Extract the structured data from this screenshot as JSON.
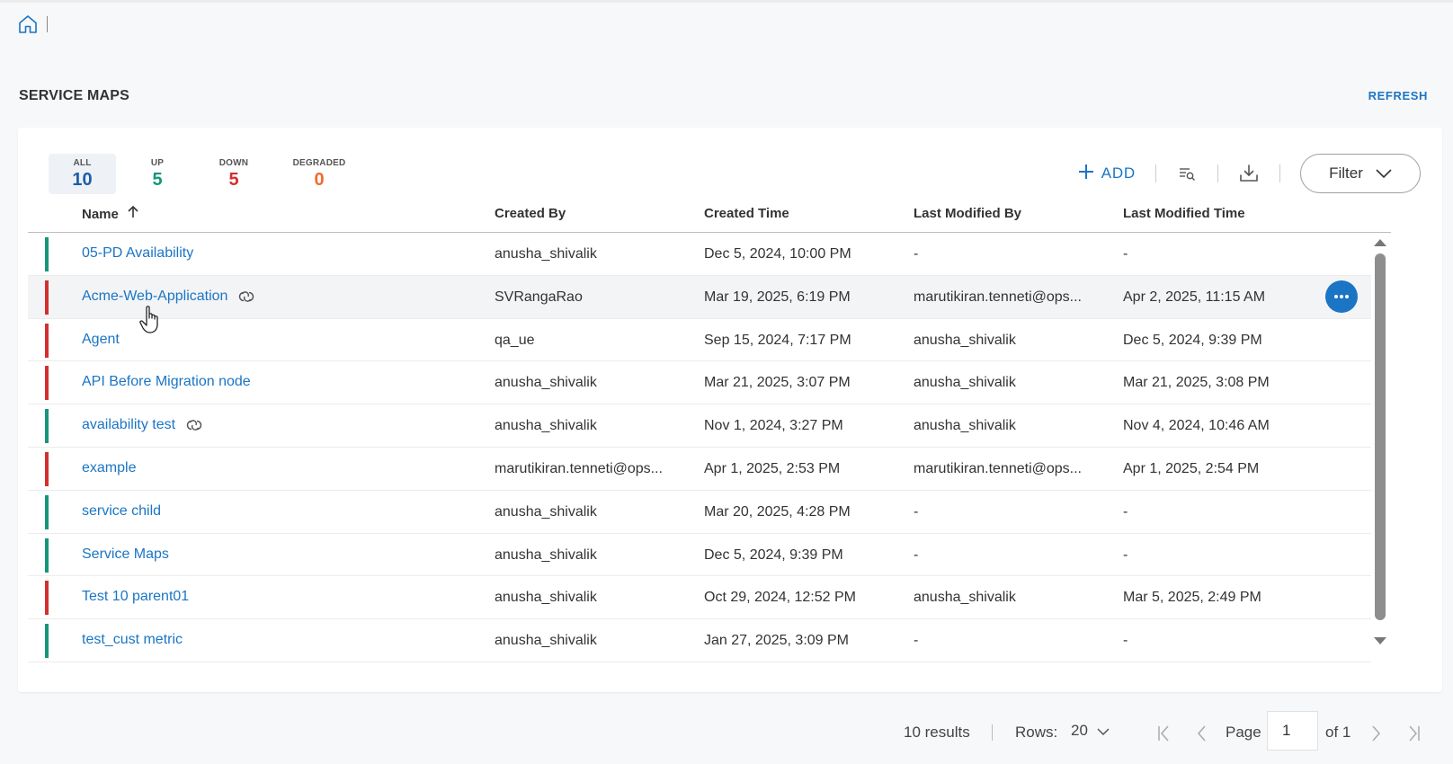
{
  "header": {
    "page_title": "SERVICE MAPS",
    "refresh_label": "REFRESH"
  },
  "stats": {
    "all": {
      "label": "ALL",
      "count": "10"
    },
    "up": {
      "label": "UP",
      "count": "5"
    },
    "down": {
      "label": "DOWN",
      "count": "5"
    },
    "degraded": {
      "label": "DEGRADED",
      "count": "0"
    }
  },
  "toolbar": {
    "add_label": "ADD",
    "filter_label": "Filter"
  },
  "columns": {
    "name": "Name",
    "created_by": "Created By",
    "created_time": "Created Time",
    "last_modified_by": "Last Modified By",
    "last_modified_time": "Last Modified Time"
  },
  "rows": [
    {
      "name": "05-PD Availability",
      "status": "up",
      "linked": false,
      "created_by": "anusha_shivalik",
      "created_time": "Dec 5, 2024, 10:00 PM",
      "modified_by": "-",
      "modified_time": "-"
    },
    {
      "name": "Acme-Web-Application",
      "status": "down",
      "linked": true,
      "created_by": "SVRangaRao",
      "created_time": "Mar 19, 2025, 6:19 PM",
      "modified_by": "marutikiran.tenneti@ops...",
      "modified_time": "Apr 2, 2025, 11:15 AM"
    },
    {
      "name": "Agent",
      "status": "down",
      "linked": false,
      "created_by": "qa_ue",
      "created_time": "Sep 15, 2024, 7:17 PM",
      "modified_by": "anusha_shivalik",
      "modified_time": "Dec 5, 2024, 9:39 PM"
    },
    {
      "name": "API Before Migration node",
      "status": "down",
      "linked": false,
      "created_by": "anusha_shivalik",
      "created_time": "Mar 21, 2025, 3:07 PM",
      "modified_by": "anusha_shivalik",
      "modified_time": "Mar 21, 2025, 3:08 PM"
    },
    {
      "name": "availability test",
      "status": "up",
      "linked": true,
      "created_by": "anusha_shivalik",
      "created_time": "Nov 1, 2024, 3:27 PM",
      "modified_by": "anusha_shivalik",
      "modified_time": "Nov 4, 2024, 10:46 AM"
    },
    {
      "name": "example",
      "status": "down",
      "linked": false,
      "created_by": "marutikiran.tenneti@ops...",
      "created_time": "Apr 1, 2025, 2:53 PM",
      "modified_by": "marutikiran.tenneti@ops...",
      "modified_time": "Apr 1, 2025, 2:54 PM"
    },
    {
      "name": "service child",
      "status": "up",
      "linked": false,
      "created_by": "anusha_shivalik",
      "created_time": "Mar 20, 2025, 4:28 PM",
      "modified_by": "-",
      "modified_time": "-"
    },
    {
      "name": "Service Maps",
      "status": "up",
      "linked": false,
      "created_by": "anusha_shivalik",
      "created_time": "Dec 5, 2024, 9:39 PM",
      "modified_by": "-",
      "modified_time": "-"
    },
    {
      "name": "Test 10 parent01",
      "status": "down",
      "linked": false,
      "created_by": "anusha_shivalik",
      "created_time": "Oct 29, 2024, 12:52 PM",
      "modified_by": "anusha_shivalik",
      "modified_time": "Mar 5, 2025, 2:49 PM"
    },
    {
      "name": "test_cust metric",
      "status": "up",
      "linked": false,
      "created_by": "anusha_shivalik",
      "created_time": "Jan 27, 2025, 3:09 PM",
      "modified_by": "-",
      "modified_time": "-"
    }
  ],
  "colors": {
    "up": "#16957a",
    "down": "#d32f2f",
    "accent": "#1b75c4"
  },
  "icons": {
    "home": "home-icon",
    "add": "plus-icon",
    "search_list": "search-list-icon",
    "download": "download-icon",
    "filter": "chevron-down-icon",
    "link": "link-icon",
    "more": "more-icon"
  },
  "pagination": {
    "results": "10 results",
    "rows_label": "Rows:",
    "rows_value": "20",
    "page_label": "Page",
    "page_value": "1",
    "of_label": "of 1"
  }
}
